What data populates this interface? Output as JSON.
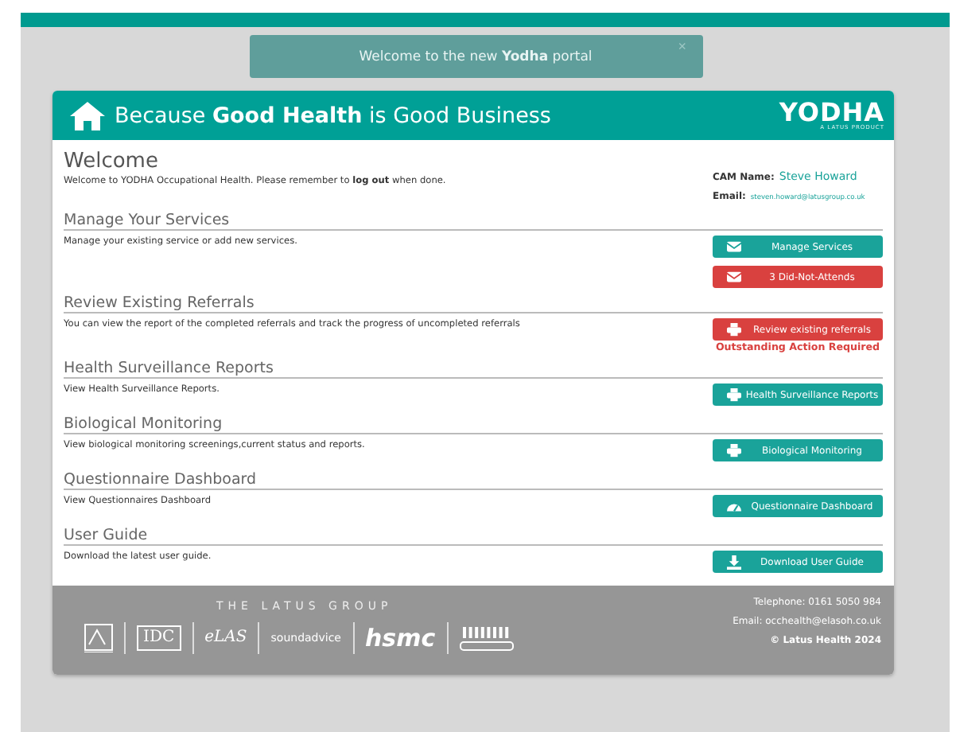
{
  "notice": {
    "text": "Welcome to the new **Yodha** portal",
    "close": "×"
  },
  "header": {
    "tagline": "Because **Good Health** is Good Business",
    "logo": "YODHA",
    "logo_sub": "A LATUS PRODUCT"
  },
  "welcome": {
    "title": "Welcome",
    "text": "Welcome to YODHA Occupational Health. Please remember to **log out** when done.",
    "cam_label": "CAM Name:",
    "cam_name": "Steve Howard",
    "email_label": "Email:",
    "email": "steven.howard@latusgroup.co.uk"
  },
  "sections": [
    {
      "title": "Manage Your Services",
      "text": "Manage your existing service or add new services.",
      "buttons": [
        {
          "label": "Manage Services",
          "color": "#1aa39a"
        },
        {
          "label": "3 Did-Not-Attends",
          "color": "#d9413f"
        }
      ]
    },
    {
      "title": "Review Existing Referrals",
      "text": "You can view the report of the completed referrals and track the progress of uncompleted referrals",
      "buttons": [
        {
          "label": "Review existing referrals",
          "color": "#d9413f"
        }
      ],
      "alert": "Outstanding Action Required"
    },
    {
      "title": "Health Surveillance Reports",
      "text": "View Health Surveillance Reports.",
      "buttons": [
        {
          "label": "Health Surveillance Reports",
          "color": "#1aa39a"
        }
      ]
    },
    {
      "title": "Biological Monitoring",
      "text": "View biological monitoring screenings,current status and reports.",
      "buttons": [
        {
          "label": "Biological Monitoring",
          "color": "#1aa39a"
        }
      ]
    },
    {
      "title": "Questionnaire Dashboard",
      "text": "View Questionnaires Dashboard",
      "buttons": [
        {
          "label": "Questionnaire Dashboard",
          "color": "#1aa39a"
        }
      ]
    },
    {
      "title": "User Guide",
      "text": "Download the latest user guide.",
      "buttons": [
        {
          "label": "Download User Guide",
          "color": "#1aa39a"
        }
      ]
    }
  ],
  "footer": {
    "group": "THE LATUS GROUP",
    "logos": [
      "IDC",
      "eLAS",
      "soundadvice",
      "hsmc"
    ],
    "telephone": "Telephone: 0161 5050 984",
    "email": "Email: occhealth@elasoh.co.uk",
    "copyright": "© Latus Health 2024"
  }
}
